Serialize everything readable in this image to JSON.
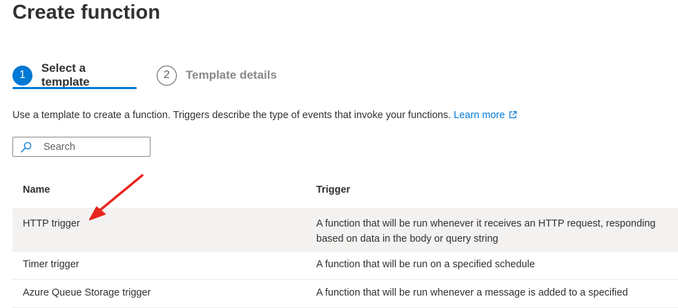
{
  "page": {
    "title": "Create function"
  },
  "wizard": {
    "steps": [
      {
        "number": "1",
        "label": "Select a template",
        "active": true
      },
      {
        "number": "2",
        "label": "Template details",
        "active": false
      }
    ]
  },
  "description": {
    "text": "Use a template to create a function. Triggers describe the type of events that invoke your functions.",
    "link_label": "Learn more",
    "link_icon": "external-link-icon"
  },
  "search": {
    "placeholder": "Search",
    "value": "",
    "icon": "search-icon"
  },
  "table": {
    "columns": [
      "Name",
      "Trigger"
    ],
    "rows": [
      {
        "name": "HTTP trigger",
        "trigger": "A function that will be run whenever it receives an HTTP request, responding based on data in the body or query string",
        "selected": true
      },
      {
        "name": "Timer trigger",
        "trigger": "A function that will be run on a specified schedule",
        "selected": false
      },
      {
        "name": "Azure Queue Storage trigger",
        "trigger": "A function that will be run whenever a message is added to a specified",
        "selected": false
      }
    ]
  },
  "annotation": {
    "arrow_color": "#e8261e"
  },
  "colors": {
    "accent": "#0078d4",
    "text": "#323130",
    "muted": "#8a8886",
    "selected_row": "#f3f2f1"
  }
}
